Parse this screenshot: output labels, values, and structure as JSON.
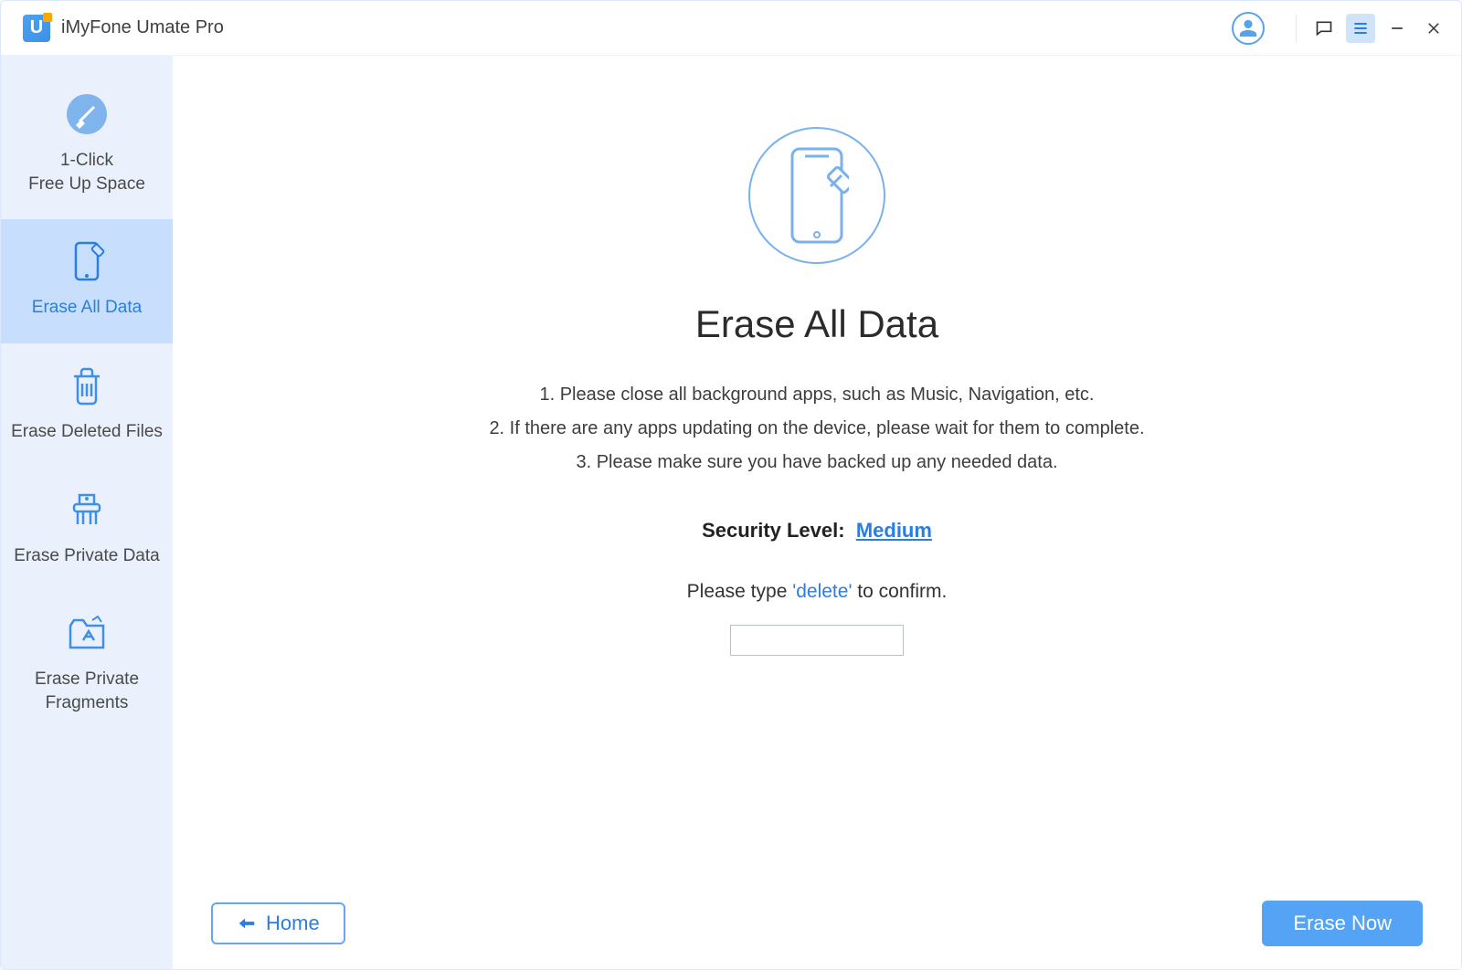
{
  "app": {
    "title": "iMyFone Umate Pro"
  },
  "sidebar": {
    "items": [
      {
        "label": "1-Click\nFree Up Space"
      },
      {
        "label": "Erase All Data"
      },
      {
        "label": "Erase Deleted Files"
      },
      {
        "label": "Erase Private Data"
      },
      {
        "label": "Erase Private\nFragments"
      }
    ]
  },
  "main": {
    "heading": "Erase All Data",
    "notes": {
      "n1": "1. Please close all background apps, such as Music, Navigation, etc.",
      "n2": "2. If there are any apps updating on the device, please wait for them to complete.",
      "n3": "3. Please make sure you have backed up any needed data."
    },
    "security": {
      "label": "Security Level:",
      "value": "Medium"
    },
    "confirm": {
      "prefix": "Please type ",
      "keyword": "'delete'",
      "suffix": " to confirm.",
      "input_value": ""
    }
  },
  "footer": {
    "home_label": "Home",
    "erase_label": "Erase Now"
  }
}
